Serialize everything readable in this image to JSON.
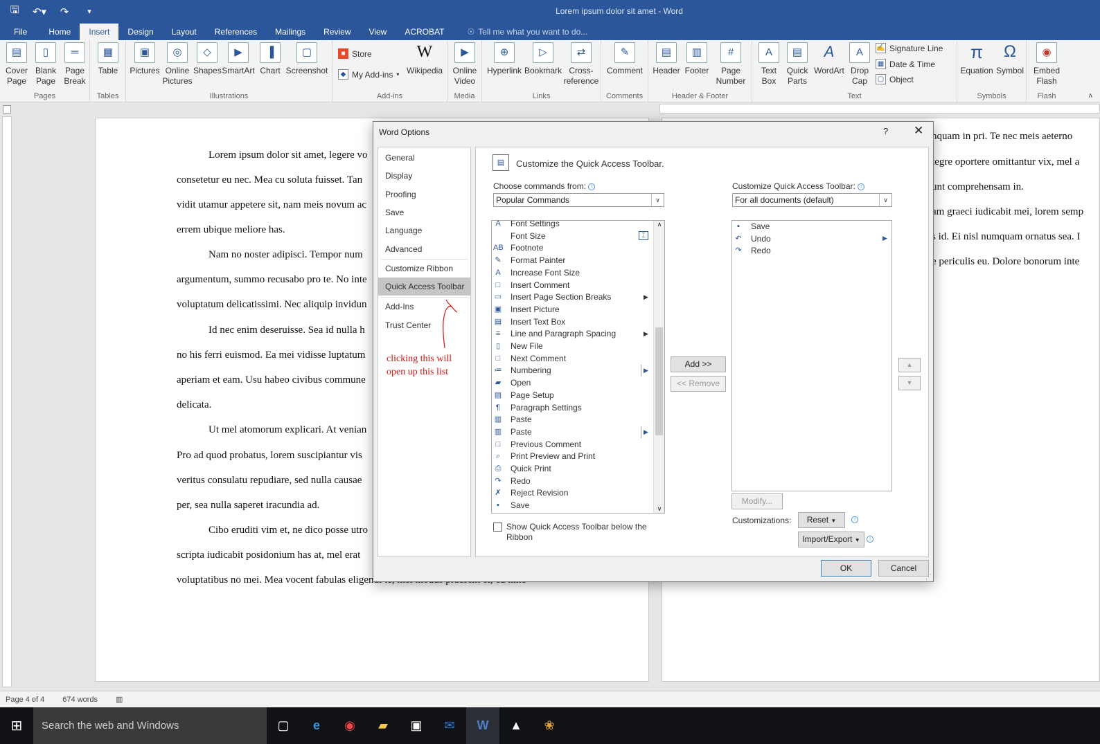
{
  "window": {
    "title": "Lorem ipsum dolor sit amet - Word"
  },
  "qat": {
    "save_icon": "save-icon",
    "undo_icon": "undo-icon",
    "redo_icon": "redo-icon",
    "customize_icon": "customize-qat-icon"
  },
  "tabs": [
    "File",
    "Home",
    "Insert",
    "Design",
    "Layout",
    "References",
    "Mailings",
    "Review",
    "View",
    "ACROBAT"
  ],
  "tell_me": "Tell me what you want to do...",
  "ribbon": {
    "pages": {
      "label": "Pages",
      "cover": "Cover\nPage",
      "blank": "Blank\nPage",
      "break": "Page\nBreak"
    },
    "tables": {
      "label": "Tables",
      "table": "Table"
    },
    "illustrations": {
      "label": "Illustrations",
      "pictures": "Pictures",
      "online": "Online\nPictures",
      "shapes": "Shapes",
      "smartart": "SmartArt",
      "chart": "Chart",
      "screenshot": "Screenshot"
    },
    "addins": {
      "label": "Add-ins",
      "store": "Store",
      "myaddins": "My Add-ins",
      "wikipedia": "Wikipedia"
    },
    "media": {
      "label": "Media",
      "video": "Online\nVideo"
    },
    "links": {
      "label": "Links",
      "hyperlink": "Hyperlink",
      "bookmark": "Bookmark",
      "crossref": "Cross-\nreference"
    },
    "comments": {
      "label": "Comments",
      "comment": "Comment"
    },
    "headerfooter": {
      "label": "Header & Footer",
      "header": "Header",
      "footer": "Footer",
      "pagenum": "Page\nNumber"
    },
    "text": {
      "label": "Text",
      "textbox": "Text\nBox",
      "quickparts": "Quick\nParts",
      "wordart": "WordArt",
      "dropcap": "Drop\nCap",
      "sigline": "Signature Line",
      "datetime": "Date & Time",
      "object": "Object"
    },
    "symbols": {
      "label": "Symbols",
      "equation": "Equation",
      "symbol": "Symbol"
    },
    "flash": {
      "label": "Flash",
      "embed": "Embed\nFlash"
    }
  },
  "document": {
    "left_lines": [
      "Lorem ipsum dolor sit amet, legere vo",
      "consetetur eu nec. Mea cu soluta fuisset. Tan",
      "vidit utamur appetere sit, nam meis novum ac",
      "errem ubique meliore has.",
      "Nam no noster adipisci. Tempor num",
      "argumentum, summo recusabo pro te. No inte",
      "voluptatum delicatissimi. Nec aliquip invidun",
      "Id nec enim deseruisse. Sea id nulla h",
      "no his ferri euismod. Ea mei vidisse luptatum",
      "aperiam et eam. Usu habeo civibus commune",
      "delicata.",
      "Ut mel atomorum explicari. At venian",
      "Pro ad quod probatus, lorem suscipiantur vis",
      "veritus consulatu repudiare, sed nulla causae",
      "per, sea nulla saperet iracundia ad.",
      "Cibo eruditi vim et, ne dico posse utro",
      "scripta iudicabit posidonium has at, mel erat",
      "voluptatibus no mei. Mea vocent fabulas eligendi te, mei modus praesent ei, cu hinc"
    ],
    "right_lines": [
      "nquam in pri. Te nec meis aeterno",
      "tegre oportere omittantur vix, mel a",
      "unt comprehensam in.",
      "am graeci iudicabit mei, lorem semp",
      "s id. Ei nisl numquam ornatus sea. I",
      "e periculis eu. Dolore bonorum inte"
    ]
  },
  "status": {
    "page": "Page 4 of 4",
    "words": "674 words"
  },
  "taskbar": {
    "search": "Search the web and Windows"
  },
  "dialog": {
    "title": "Word Options",
    "help": "?",
    "nav": [
      "General",
      "Display",
      "Proofing",
      "Save",
      "Language",
      "Advanced",
      "Customize Ribbon",
      "Quick Access Toolbar",
      "Add-Ins",
      "Trust Center"
    ],
    "annotation": "clicking this will\nopen up this list",
    "heading": "Customize the Quick Access Toolbar.",
    "choose_label": "Choose commands from:",
    "choose_value": "Popular Commands",
    "customize_label": "Customize Quick Access Toolbar:",
    "customize_value": "For all documents (default)",
    "commands": [
      {
        "label": "Font Settings",
        "icon": "A"
      },
      {
        "label": "Font Size",
        "icon": ""
      },
      {
        "label": "Footnote",
        "icon": "AB"
      },
      {
        "label": "Format Painter",
        "icon": "✎"
      },
      {
        "label": "Increase Font Size",
        "icon": "A"
      },
      {
        "label": "Insert Comment",
        "icon": "□"
      },
      {
        "label": "Insert Page  Section Breaks",
        "icon": "▭"
      },
      {
        "label": "Insert Picture",
        "icon": "▣"
      },
      {
        "label": "Insert Text Box",
        "icon": "▤"
      },
      {
        "label": "Line and Paragraph Spacing",
        "icon": "≡"
      },
      {
        "label": "New File",
        "icon": "▯"
      },
      {
        "label": "Next Comment",
        "icon": "□"
      },
      {
        "label": "Numbering",
        "icon": "≔"
      },
      {
        "label": "Open",
        "icon": "▰"
      },
      {
        "label": "Page Setup",
        "icon": "▤"
      },
      {
        "label": "Paragraph Settings",
        "icon": "¶"
      },
      {
        "label": "Paste",
        "icon": "▥"
      },
      {
        "label": "Paste",
        "icon": "▥"
      },
      {
        "label": "Previous Comment",
        "icon": "□"
      },
      {
        "label": "Print Preview and Print",
        "icon": "⌕"
      },
      {
        "label": "Quick Print",
        "icon": "⎙"
      },
      {
        "label": "Redo",
        "icon": "↷"
      },
      {
        "label": "Reject Revision",
        "icon": "✗"
      },
      {
        "label": "Save",
        "icon": "▪"
      }
    ],
    "qat_items": [
      {
        "label": "Save",
        "icon": "▪"
      },
      {
        "label": "Undo",
        "icon": "↶"
      },
      {
        "label": "Redo",
        "icon": "↷"
      }
    ],
    "add": "Add >>",
    "remove": "<< Remove",
    "show_below": "Show Quick Access Toolbar below the\nRibbon",
    "modify": "Modify...",
    "customizations_label": "Customizations:",
    "reset": "Reset",
    "import_export": "Import/Export",
    "ok": "OK",
    "cancel": "Cancel"
  }
}
